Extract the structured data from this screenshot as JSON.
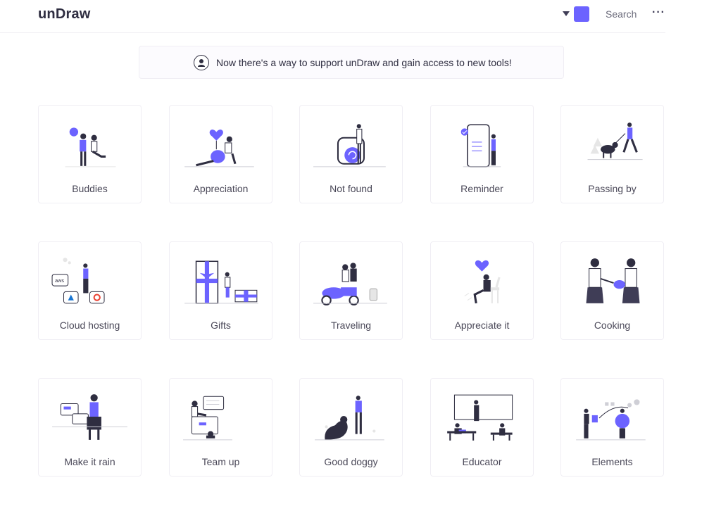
{
  "header": {
    "logo": "unDraw",
    "search_label": "Search",
    "more_label": "···",
    "accent_color": "#6c63ff"
  },
  "banner": {
    "text": "Now there's a way to support unDraw and gain access to new tools!",
    "icon": "avatar-icon"
  },
  "illustrations": [
    {
      "label": "Buddies"
    },
    {
      "label": "Appreciation"
    },
    {
      "label": "Not found"
    },
    {
      "label": "Reminder"
    },
    {
      "label": "Passing by"
    },
    {
      "label": "Cloud hosting"
    },
    {
      "label": "Gifts"
    },
    {
      "label": "Traveling"
    },
    {
      "label": "Appreciate it"
    },
    {
      "label": "Cooking"
    },
    {
      "label": "Make it rain"
    },
    {
      "label": "Team up"
    },
    {
      "label": "Good doggy"
    },
    {
      "label": "Educator"
    },
    {
      "label": "Elements"
    }
  ]
}
